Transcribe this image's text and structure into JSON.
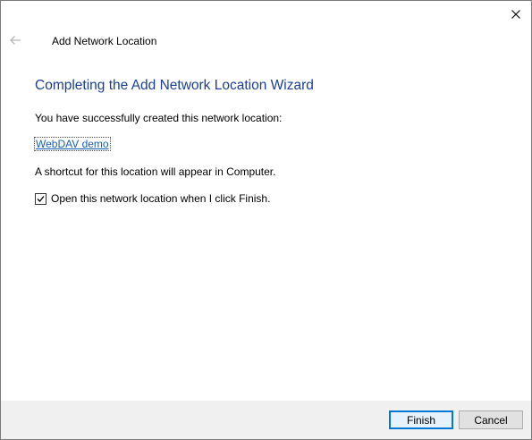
{
  "window": {
    "title": "Add Network Location",
    "close_label": "Close"
  },
  "wizard": {
    "heading": "Completing the Add Network Location Wizard",
    "success_text": "You have successfully created this network location:",
    "location_link": "WebDAV demo",
    "shortcut_text": "A shortcut for this location will appear in Computer.",
    "open_checkbox": {
      "label": "Open this network location when I click Finish.",
      "checked": true
    }
  },
  "buttons": {
    "finish": "Finish",
    "cancel": "Cancel"
  },
  "icons": {
    "back": "back-arrow-icon",
    "close": "close-icon",
    "check": "checkmark-icon"
  }
}
